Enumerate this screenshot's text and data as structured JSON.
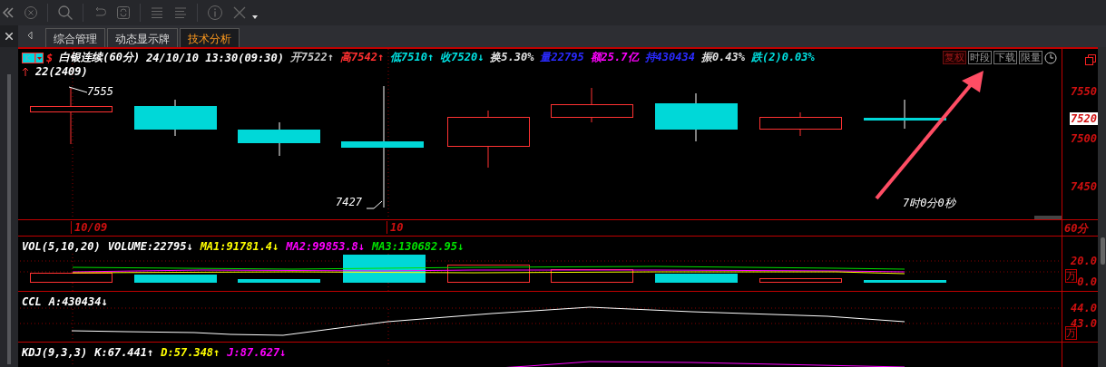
{
  "tabs": [
    {
      "label": "综合管理",
      "selected": false
    },
    {
      "label": "动态显示牌",
      "selected": false
    },
    {
      "label": "技术分析",
      "selected": true
    }
  ],
  "quote": {
    "currency_mark": "$",
    "contract": "22(2409)",
    "fields": [
      {
        "text": "白银连续(60分)",
        "color": "#ffffff"
      },
      {
        "text": "24/10/10 13:30(09:30)",
        "color": "#ffffff"
      },
      {
        "text": "开7522↑",
        "color": "#c8c8c8"
      },
      {
        "text": "高7542↑",
        "color": "#ff3030"
      },
      {
        "text": "低7510↑",
        "color": "#00e0e0"
      },
      {
        "text": "收7520↓",
        "color": "#00e0e0"
      },
      {
        "text": "换5.30%",
        "color": "#e0e0e0"
      },
      {
        "text": "量22795",
        "color": "#2a2aff"
      },
      {
        "text": "额25.7亿",
        "color": "#ff00ff"
      },
      {
        "text": "持430434",
        "color": "#2a2aff"
      },
      {
        "text": "振0.43%",
        "color": "#e0e0e0"
      },
      {
        "text": "跌(2)0.03%",
        "color": "#00e0e0"
      }
    ]
  },
  "tools": [
    {
      "label": "复权",
      "active": true
    },
    {
      "label": "时段",
      "active": false
    },
    {
      "label": "下载",
      "active": false
    },
    {
      "label": "限量",
      "active": false
    }
  ],
  "price_chart": {
    "high_label": "7555",
    "low_label": "7427",
    "countdown": "7时0分0秒",
    "ticks": [
      "7550",
      "7500",
      "7450"
    ],
    "last_price": "7520",
    "period": "60分",
    "dates": [
      "10/09",
      "10"
    ]
  },
  "panes": [
    {
      "kind": "vol",
      "ticks": [
        "20.0",
        "0.0"
      ],
      "unit": "万",
      "fields": [
        {
          "text": "VOL(5,10,20)",
          "color": "#ffffff"
        },
        {
          "text": "VOLUME:22795↓",
          "color": "#ffffff"
        },
        {
          "text": "MA1:91781.4↓",
          "color": "#ffff00"
        },
        {
          "text": "MA2:99853.8↓",
          "color": "#ff00ff"
        },
        {
          "text": "MA3:130682.95↓",
          "color": "#00e000"
        }
      ]
    },
    {
      "kind": "ccl",
      "ticks": [
        "44.0",
        "43.0"
      ],
      "unit": "万",
      "fields": [
        {
          "text": "CCL",
          "color": "#ffffff"
        },
        {
          "text": "A:430434↓",
          "color": "#ffffff"
        }
      ]
    },
    {
      "kind": "kdj",
      "fields": [
        {
          "text": "KDJ(9,3,3)",
          "color": "#ffffff"
        },
        {
          "text": "K:67.441↑",
          "color": "#ffffff"
        },
        {
          "text": "D:57.348↑",
          "color": "#ffff00"
        },
        {
          "text": "J:87.627↓",
          "color": "#ff00ff"
        }
      ]
    }
  ]
}
